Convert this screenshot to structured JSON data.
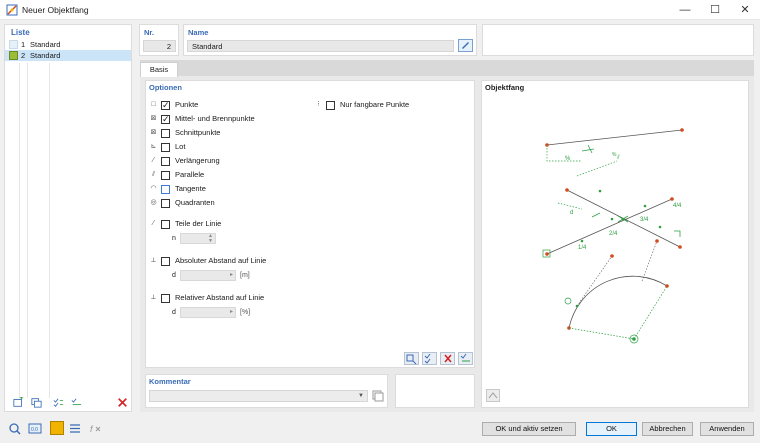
{
  "window": {
    "title": "Neuer Objektfang",
    "minimize": "—",
    "maximize": "☐",
    "close": "✕"
  },
  "list": {
    "header": "Liste",
    "items": [
      {
        "num": "1",
        "label": "Standard",
        "color": "#e6f0f8"
      },
      {
        "num": "2",
        "label": "Standard",
        "color": "#9bbb3a"
      }
    ]
  },
  "nr": {
    "label": "Nr.",
    "value": "2"
  },
  "name": {
    "label": "Name",
    "value": "Standard"
  },
  "tab": {
    "label": "Basis"
  },
  "options": {
    "header": "Optionen",
    "items": [
      {
        "label": "Punkte",
        "checked": true,
        "icon": "□"
      },
      {
        "label": "Mittel- und Brennpunkte",
        "checked": true,
        "icon": "⊠"
      },
      {
        "label": "Schnittpunkte",
        "checked": false,
        "icon": "⊠"
      },
      {
        "label": "Lot",
        "checked": false,
        "icon": "⊾"
      },
      {
        "label": "Verlängerung",
        "checked": false,
        "icon": "⁄"
      },
      {
        "label": "Parallele",
        "checked": false,
        "icon": "⫽"
      },
      {
        "label": "Tangente",
        "checked": false,
        "icon": "◠"
      },
      {
        "label": "Quadranten",
        "checked": false,
        "icon": "◎"
      }
    ],
    "fangbar": "Nur fangbare Punkte",
    "teile": "Teile der Linie",
    "n_label": "n",
    "abs": "Absoluter Abstand auf Linie",
    "abs_d": "d",
    "abs_unit": "[m]",
    "rel": "Relativer Abstand auf Linie",
    "rel_d": "d",
    "rel_unit": "[%]"
  },
  "preview": {
    "header": "Objektfang"
  },
  "comment": {
    "header": "Kommentar"
  },
  "buttons": {
    "ok_set": "OK und aktiv setzen",
    "ok": "OK",
    "cancel": "Abbrechen",
    "apply": "Anwenden"
  },
  "colors": {
    "accent": "#3a6bb5",
    "node": "#d24a1e",
    "snap": "#2ea043"
  }
}
